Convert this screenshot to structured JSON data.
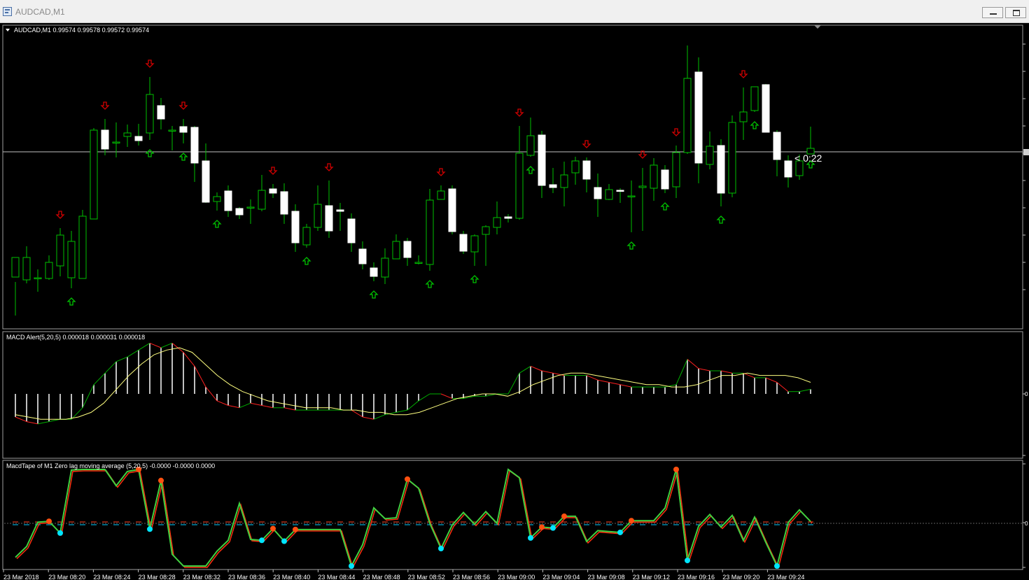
{
  "window": {
    "title": "AUDCAD,M1"
  },
  "main_chart": {
    "header": "AUDCAD,M1  0.99574 0.99578 0.99572 0.99574",
    "timer": "< 0:22",
    "colors": {
      "background": "#000000",
      "bull_body": "#000000",
      "bear_body": "#ffffff",
      "wick": "#00c000",
      "arrow_up": "#00c000",
      "arrow_down": "#d00000",
      "price_line": "#c0c0c0"
    }
  },
  "macd_panel": {
    "header": "MACD Alert(5,20,5) 0.000018 0.000031 0.000018",
    "scale_label": "0",
    "colors": {
      "histogram": "#ffffff",
      "macd_line_up": "#00b000",
      "macd_line_down": "#ff2020",
      "signal": "#ffff80"
    }
  },
  "tape_panel": {
    "header": "MacdTape of M1 Zero lag moving average (5,20,5) -0.0000 -0.0000 0.0000",
    "scale_label": "0",
    "colors": {
      "line_fast": "#40d040",
      "line_slow": "#ff3010",
      "dot_up": "#00e5ff",
      "dot_down": "#ff5010",
      "zero_up": "#00ccff",
      "zero_down": "#ff4020"
    }
  },
  "time_axis": {
    "labels": [
      "23 Mar 2018",
      "23 Mar 08:20",
      "23 Mar 08:24",
      "23 Mar 08:28",
      "23 Mar 08:32",
      "23 Mar 08:36",
      "23 Mar 08:40",
      "23 Mar 08:44",
      "23 Mar 08:48",
      "23 Mar 08:52",
      "23 Mar 08:56",
      "23 Mar 09:00",
      "23 Mar 09:04",
      "23 Mar 09:08",
      "23 Mar 09:12",
      "23 Mar 09:16",
      "23 Mar 09:20",
      "23 Mar 09:24"
    ]
  },
  "chart_data": {
    "type": "candlestick",
    "symbol": "AUDCAD",
    "timeframe": "M1",
    "last_ohlc": [
      0.99574,
      0.99578,
      0.99572,
      0.99574
    ],
    "candles": [
      [
        396,
        368,
        403,
        451
      ],
      [
        400,
        368,
        352,
        405
      ],
      [
        397,
        397,
        385,
        417
      ],
      [
        398,
        375,
        365,
        400
      ],
      [
        380,
        336,
        326,
        395
      ],
      [
        397,
        345,
        330,
        412
      ],
      [
        398,
        309,
        300,
        398
      ],
      [
        313,
        186,
        183,
        313
      ],
      [
        186,
        213,
        170,
        222
      ],
      [
        203,
        203,
        175,
        225
      ],
      [
        195,
        190,
        178,
        210
      ],
      [
        195,
        201,
        177,
        208
      ],
      [
        190,
        135,
        110,
        200
      ],
      [
        151,
        170,
        140,
        185
      ],
      [
        186,
        186,
        180,
        215
      ],
      [
        181,
        189,
        170,
        205
      ],
      [
        182,
        233,
        180,
        260
      ],
      [
        230,
        289,
        205,
        290
      ],
      [
        288,
        281,
        275,
        301
      ],
      [
        273,
        301,
        265,
        310
      ],
      [
        298,
        307,
        296,
        313
      ],
      [
        296,
        296,
        285,
        320
      ],
      [
        299,
        272,
        250,
        302
      ],
      [
        270,
        276,
        263,
        283
      ],
      [
        274,
        306,
        262,
        320
      ],
      [
        302,
        347,
        292,
        360
      ],
      [
        350,
        325,
        320,
        354
      ],
      [
        325,
        292,
        265,
        330
      ],
      [
        294,
        330,
        258,
        340
      ],
      [
        300,
        302,
        290,
        330
      ],
      [
        313,
        347,
        305,
        360
      ],
      [
        356,
        377,
        345,
        385
      ],
      [
        383,
        395,
        375,
        402
      ],
      [
        396,
        369,
        355,
        406
      ],
      [
        370,
        345,
        335,
        370
      ],
      [
        345,
        368,
        340,
        380
      ],
      [
        375,
        375,
        365,
        378
      ],
      [
        378,
        286,
        270,
        387
      ],
      [
        285,
        273,
        265,
        285
      ],
      [
        270,
        331,
        265,
        335
      ],
      [
        335,
        359,
        330,
        363
      ],
      [
        360,
        337,
        335,
        380
      ],
      [
        335,
        324,
        322,
        380
      ],
      [
        325,
        311,
        288,
        335
      ],
      [
        310,
        312,
        306,
        318
      ],
      [
        312,
        219,
        180,
        314
      ],
      [
        222,
        194,
        168,
        224
      ],
      [
        193,
        265,
        187,
        283
      ],
      [
        264,
        268,
        240,
        276
      ],
      [
        268,
        250,
        231,
        295
      ],
      [
        247,
        230,
        224,
        264
      ],
      [
        230,
        256,
        225,
        275
      ],
      [
        268,
        284,
        248,
        310
      ],
      [
        285,
        271,
        263,
        286
      ],
      [
        272,
        273,
        269,
        290
      ],
      [
        281,
        280,
        258,
        332
      ],
      [
        268,
        266,
        240,
        330
      ],
      [
        269,
        236,
        226,
        287
      ],
      [
        243,
        270,
        236,
        276
      ],
      [
        267,
        218,
        208,
        283
      ],
      [
        218,
        112,
        65,
        220
      ],
      [
        103,
        233,
        82,
        262
      ],
      [
        235,
        209,
        188,
        242
      ],
      [
        208,
        276,
        199,
        295
      ],
      [
        276,
        175,
        165,
        282
      ],
      [
        174,
        160,
        125,
        200
      ],
      [
        158,
        124,
        135,
        160
      ],
      [
        121,
        189,
        120,
        185
      ],
      [
        189,
        228,
        186,
        252
      ],
      [
        230,
        253,
        222,
        268
      ],
      [
        251,
        230,
        221,
        257
      ],
      [
        220,
        212,
        181,
        216
      ]
    ],
    "macd_histogram": [
      -1.0,
      -1.2,
      -1.3,
      -1.2,
      -1.1,
      -1.1,
      -0.6,
      0.4,
      0.9,
      1.4,
      1.6,
      1.9,
      2.2,
      2.0,
      2.2,
      1.8,
      1.2,
      0.3,
      -0.3,
      -0.5,
      -0.6,
      -0.4,
      -0.5,
      -0.6,
      -0.6,
      -0.7,
      -0.7,
      -0.7,
      -0.7,
      -0.7,
      -0.7,
      -1.0,
      -1.1,
      -0.9,
      -0.8,
      -0.7,
      -0.3,
      0.0,
      0.0,
      -0.2,
      -0.2,
      -0.1,
      -0.1,
      0.0,
      0.0,
      0.9,
      1.2,
      1.0,
      0.9,
      0.8,
      0.8,
      0.8,
      0.6,
      0.5,
      0.4,
      0.3,
      0.3,
      0.3,
      0.3,
      0.4,
      1.5,
      1.1,
      1.0,
      1.0,
      0.9,
      0.9,
      0.7,
      0.7,
      0.5,
      0.1,
      0.1,
      0.2
    ],
    "macd_signal": [
      -0.9,
      -1.0,
      -1.1,
      -1.1,
      -1.1,
      -1.0,
      -0.8,
      -0.4,
      0.2,
      0.8,
      1.3,
      1.7,
      1.9,
      2.0,
      1.8,
      1.3,
      0.8,
      0.4,
      0.1,
      -0.1,
      -0.3,
      -0.4,
      -0.5,
      -0.6,
      -0.6,
      -0.6,
      -0.7,
      -0.7,
      -0.8,
      -0.8,
      -0.9,
      -0.9,
      -0.8,
      -0.6,
      -0.4,
      -0.2,
      -0.1,
      0.0,
      0.0,
      -0.1,
      0.1,
      0.4,
      0.6,
      0.8,
      0.9,
      0.9,
      0.8,
      0.7,
      0.6,
      0.5,
      0.4,
      0.4,
      0.3,
      0.3,
      0.4,
      0.6,
      0.8,
      0.8,
      0.9,
      0.8,
      0.8,
      0.8,
      0.7,
      0.5
    ]
  }
}
